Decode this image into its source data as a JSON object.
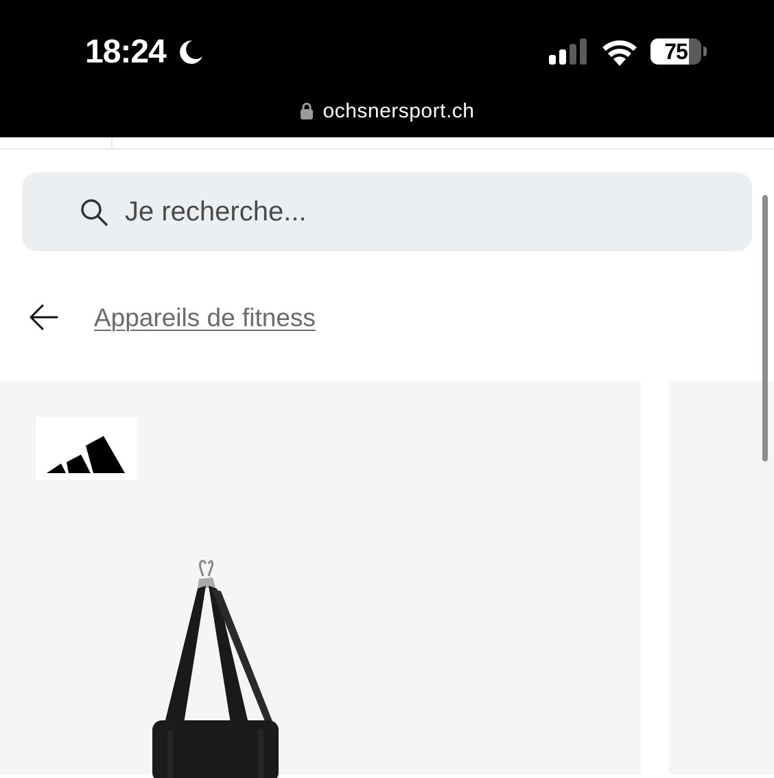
{
  "status_bar": {
    "time": "18:24",
    "moon_icon": "moon-icon",
    "signal_icon": "cellular-signal-icon",
    "wifi_icon": "wifi-icon",
    "battery_level": 75,
    "battery_text": "75"
  },
  "browser": {
    "url": "ochsnersport.ch",
    "lock_icon": "lock-icon"
  },
  "search": {
    "placeholder": "Je recherche...",
    "value": "",
    "icon": "search-icon"
  },
  "breadcrumb": {
    "back_icon": "arrow-left-icon",
    "link_label": "Appareils de fitness"
  },
  "product_card": {
    "brand_logo": "adidas-logo",
    "image": "punching-bag-image"
  },
  "colors": {
    "status_bar_bg": "#000000",
    "search_bg": "#eceff2",
    "card_bg": "#f5f5f5",
    "link_color": "#6a6a6a"
  }
}
